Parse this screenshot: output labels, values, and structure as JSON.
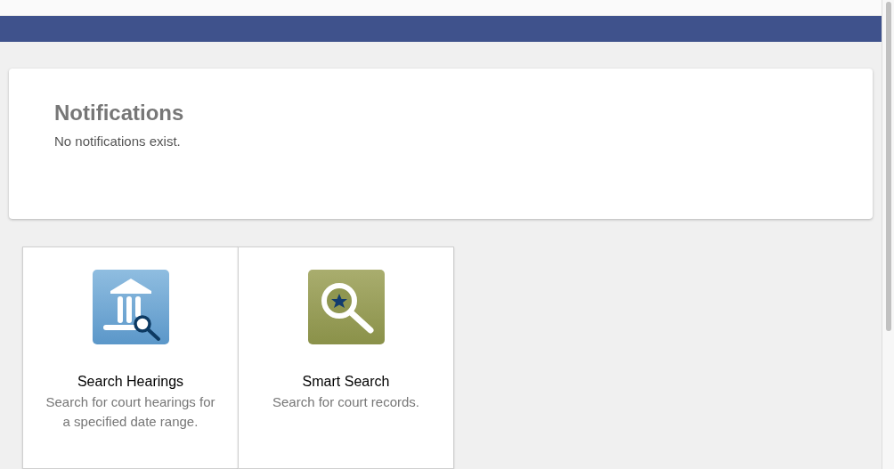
{
  "notifications": {
    "title": "Notifications",
    "message": "No notifications exist."
  },
  "tiles": [
    {
      "kind": "hearings",
      "title": "Search Hearings",
      "description": "Search for court hearings for a specified date range."
    },
    {
      "kind": "smart",
      "title": "Smart Search",
      "description": "Search for court records."
    }
  ]
}
